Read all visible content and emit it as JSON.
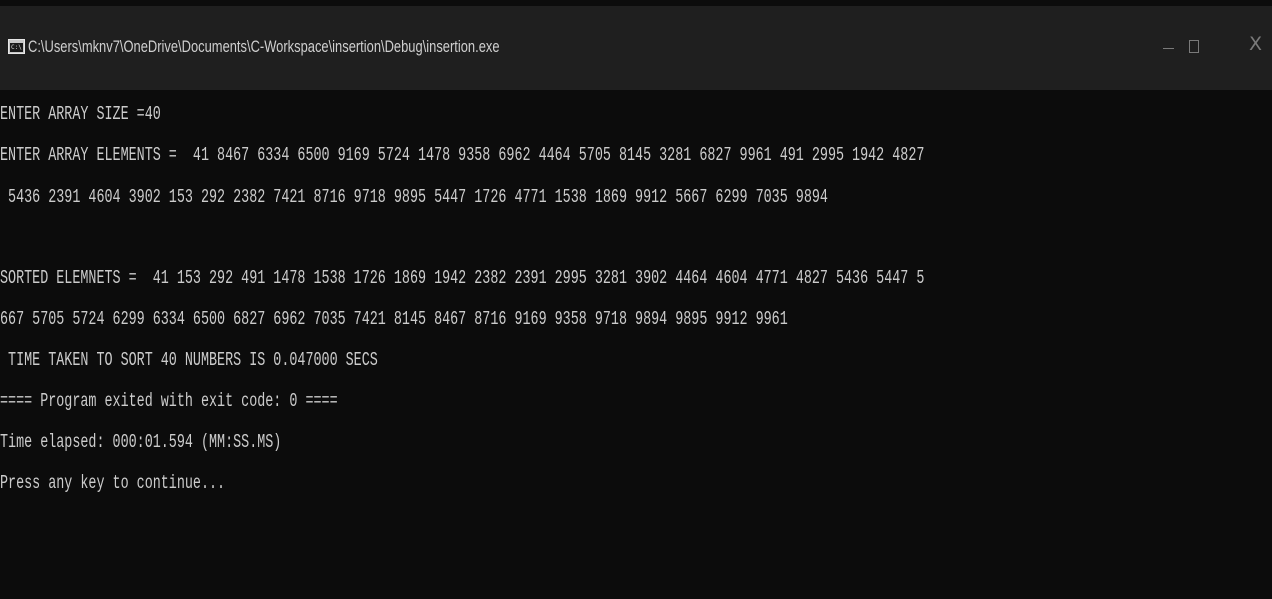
{
  "window": {
    "title": "C:\\Users\\mknv7\\OneDrive\\Documents\\C-Workspace\\insertion\\Debug\\insertion.exe",
    "icon": "console-app-icon",
    "icon_label": "C:\\",
    "controls": {
      "close_glyph": "X"
    }
  },
  "console": {
    "lines": [
      "ENTER ARRAY SIZE =40",
      "ENTER ARRAY ELEMENTS =  41 8467 6334 6500 9169 5724 1478 9358 6962 4464 5705 8145 3281 6827 9961 491 2995 1942 4827",
      " 5436 2391 4604 3902 153 292 2382 7421 8716 9718 9895 5447 1726 4771 1538 1869 9912 5667 6299 7035 9894",
      "",
      "SORTED ELEMNETS =  41 153 292 491 1478 1538 1726 1869 1942 2382 2391 2995 3281 3902 4464 4604 4771 4827 5436 5447 5",
      "667 5705 5724 6299 6334 6500 6827 6962 7035 7421 8145 8467 8716 9169 9358 9718 9894 9895 9912 9961",
      " TIME TAKEN TO SORT 40 NUMBERS IS 0.047000 SECS",
      "==== Program exited with exit code: 0 ====",
      "Time elapsed: 000:01.594 (MM:SS.MS)",
      "Press any key to continue..."
    ]
  },
  "colors": {
    "background": "#0c0c0c",
    "titlebar": "#1f1f1f",
    "text": "#cccccc"
  }
}
